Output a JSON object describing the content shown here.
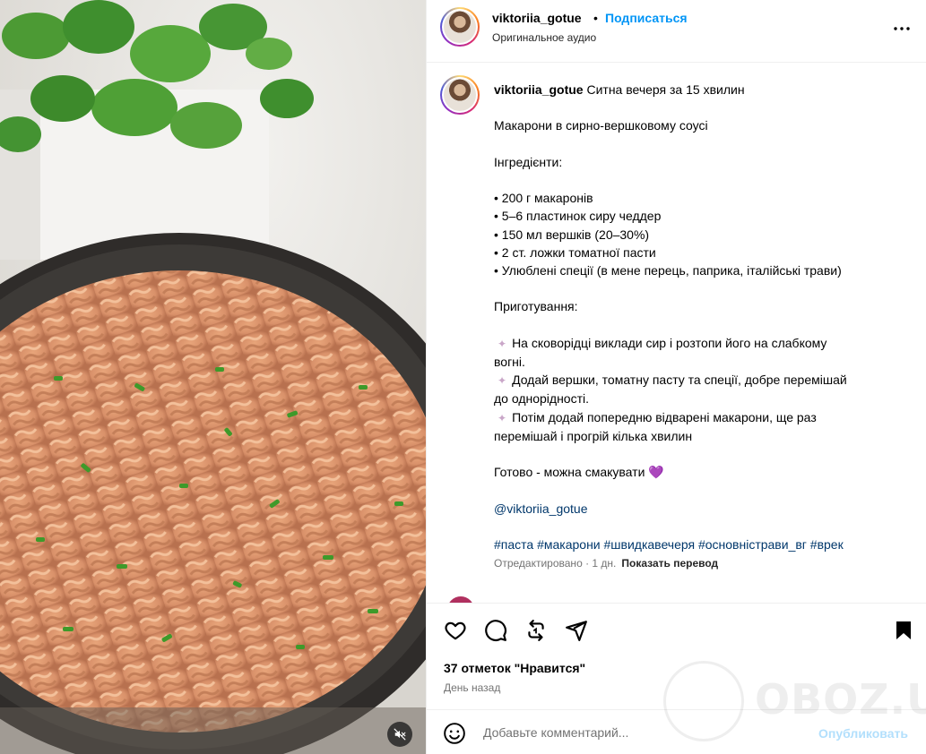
{
  "header": {
    "username": "viktoriia_gotue",
    "separator": "•",
    "follow_label": "Подписаться",
    "audio_label": "Оригинальное аудио"
  },
  "caption": {
    "username": "viktoriia_gotue",
    "title": "Ситна вечеря за 15 хвилин",
    "subtitle": "Макарони в сирно-вершковому соусі",
    "ingredients_heading": "Інгредієнти:",
    "ingredients": [
      "• 200 г макаронів",
      "• 5–6 пластинок сиру чеддер",
      "• 150 мл вершків (20–30%)",
      "• 2 ст. ложки томатної пасти",
      "• Улюблені спеції (в мене перець, паприка, італійські трави)"
    ],
    "steps_heading": "Приготування:",
    "steps": [
      {
        "line1": "На сковорідці виклади сир і розтопи його на слабкому",
        "line2": "вогні."
      },
      {
        "line1": "Додай вершки, томатну пасту та спеції, добре перемішай",
        "line2": "до однорідності."
      },
      {
        "line1": "Потім додай попередню відварені макарони, ще раз",
        "line2": "перемішай і прогрій кілька хвилин"
      }
    ],
    "closing": "Готово - можна смакувати",
    "closing_emoji": "💜",
    "mention": "@viktoriia_gotue",
    "hashtags": "#паста #макарони #швидкавечеря #основністрави_вг #врек"
  },
  "meta": {
    "edited": "Отредактировано · 1 дн.",
    "translate_label": "Показать перевод"
  },
  "actions": {
    "likes": "37 отметок \"Нравится\"",
    "date": "День назад"
  },
  "comment_box": {
    "placeholder": "Добавьте комментарий...",
    "publish_label": "Опубликовать"
  },
  "watermark": {
    "text": "OBOZ.UA"
  },
  "icons": {
    "more": "more-horizontal-icon",
    "like": "heart-icon",
    "comment": "comment-bubble-icon",
    "repost": "repost-icon",
    "share": "send-icon",
    "save": "bookmark-icon",
    "emoji": "emoji-icon",
    "mute": "muted-speaker-icon"
  },
  "colors": {
    "link_blue": "#0095f6",
    "text_secondary": "#737373",
    "publish_disabled": "#b2dffc"
  }
}
